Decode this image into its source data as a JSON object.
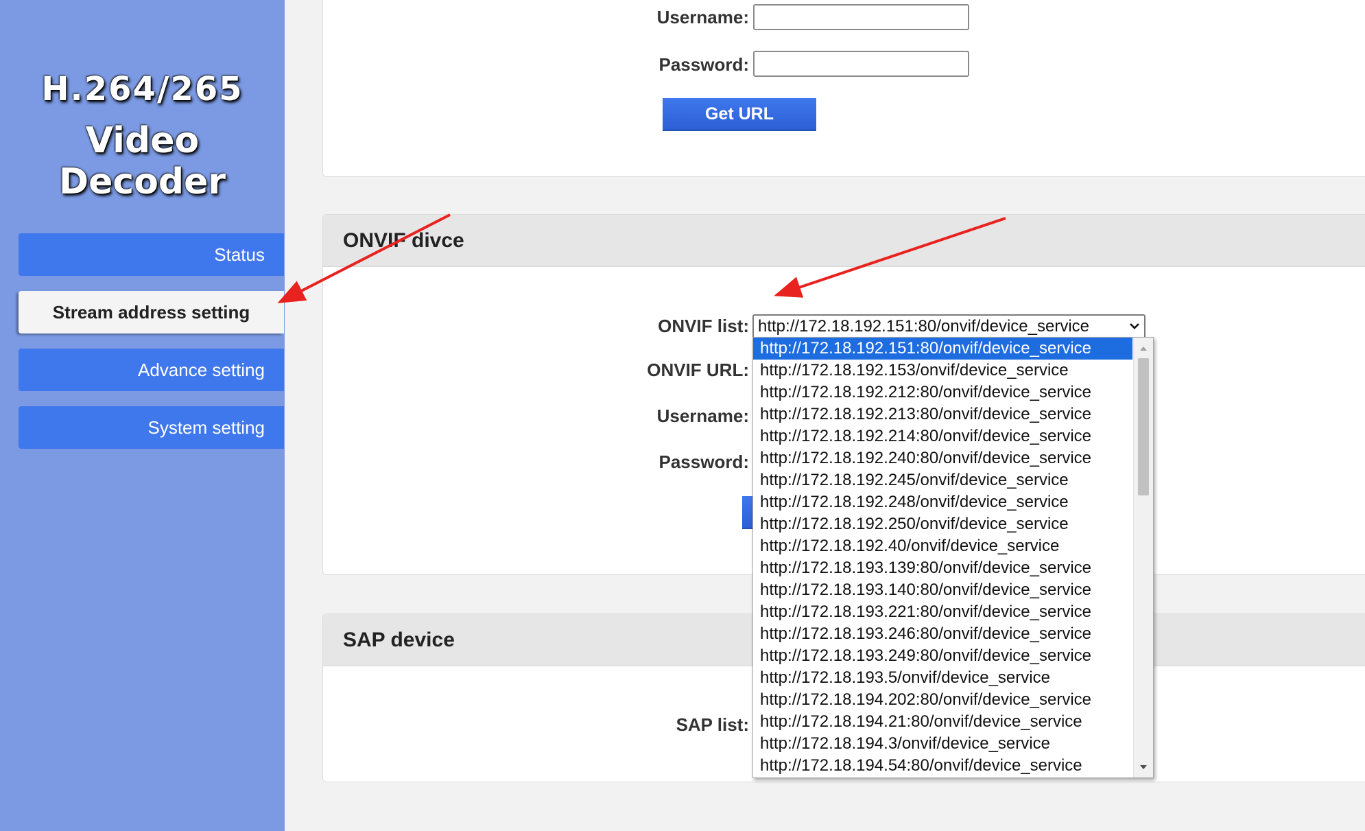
{
  "sidebar": {
    "logo_line1": "H.264/265",
    "logo_line2": "Video Decoder",
    "items": [
      {
        "label": "Status",
        "active": false
      },
      {
        "label": "Stream address setting",
        "active": true
      },
      {
        "label": "Advance setting",
        "active": false
      },
      {
        "label": "System setting",
        "active": false
      }
    ]
  },
  "top_panel": {
    "username_label": "Username:",
    "username_value": "",
    "password_label": "Password:",
    "password_value": "",
    "get_url_button": "Get URL"
  },
  "onvif_panel": {
    "title": "ONVIF divce",
    "list_label": "ONVIF list:",
    "selected_value": "http://172.18.192.151:80/onvif/device_service",
    "url_label": "ONVIF URL:",
    "username_label": "Username:",
    "password_label": "Password:",
    "options": [
      "http://172.18.192.151:80/onvif/device_service",
      "http://172.18.192.153/onvif/device_service",
      "http://172.18.192.212:80/onvif/device_service",
      "http://172.18.192.213:80/onvif/device_service",
      "http://172.18.192.214:80/onvif/device_service",
      "http://172.18.192.240:80/onvif/device_service",
      "http://172.18.192.245/onvif/device_service",
      "http://172.18.192.248/onvif/device_service",
      "http://172.18.192.250/onvif/device_service",
      "http://172.18.192.40/onvif/device_service",
      "http://172.18.193.139:80/onvif/device_service",
      "http://172.18.193.140:80/onvif/device_service",
      "http://172.18.193.221:80/onvif/device_service",
      "http://172.18.193.246:80/onvif/device_service",
      "http://172.18.193.249:80/onvif/device_service",
      "http://172.18.193.5/onvif/device_service",
      "http://172.18.194.202:80/onvif/device_service",
      "http://172.18.194.21:80/onvif/device_service",
      "http://172.18.194.3/onvif/device_service",
      "http://172.18.194.54:80/onvif/device_service"
    ]
  },
  "sap_panel": {
    "title": "SAP device",
    "list_label": "SAP list:"
  },
  "colors": {
    "sidebar_bg": "#7b9ae3",
    "button_blue": "#3f77ec",
    "selected_option": "#1d6ce0",
    "annotation_arrow": "#e8221f"
  },
  "icons": {
    "select_arrow": "chevron-down-icon",
    "annotation": "red-arrow-icon"
  }
}
